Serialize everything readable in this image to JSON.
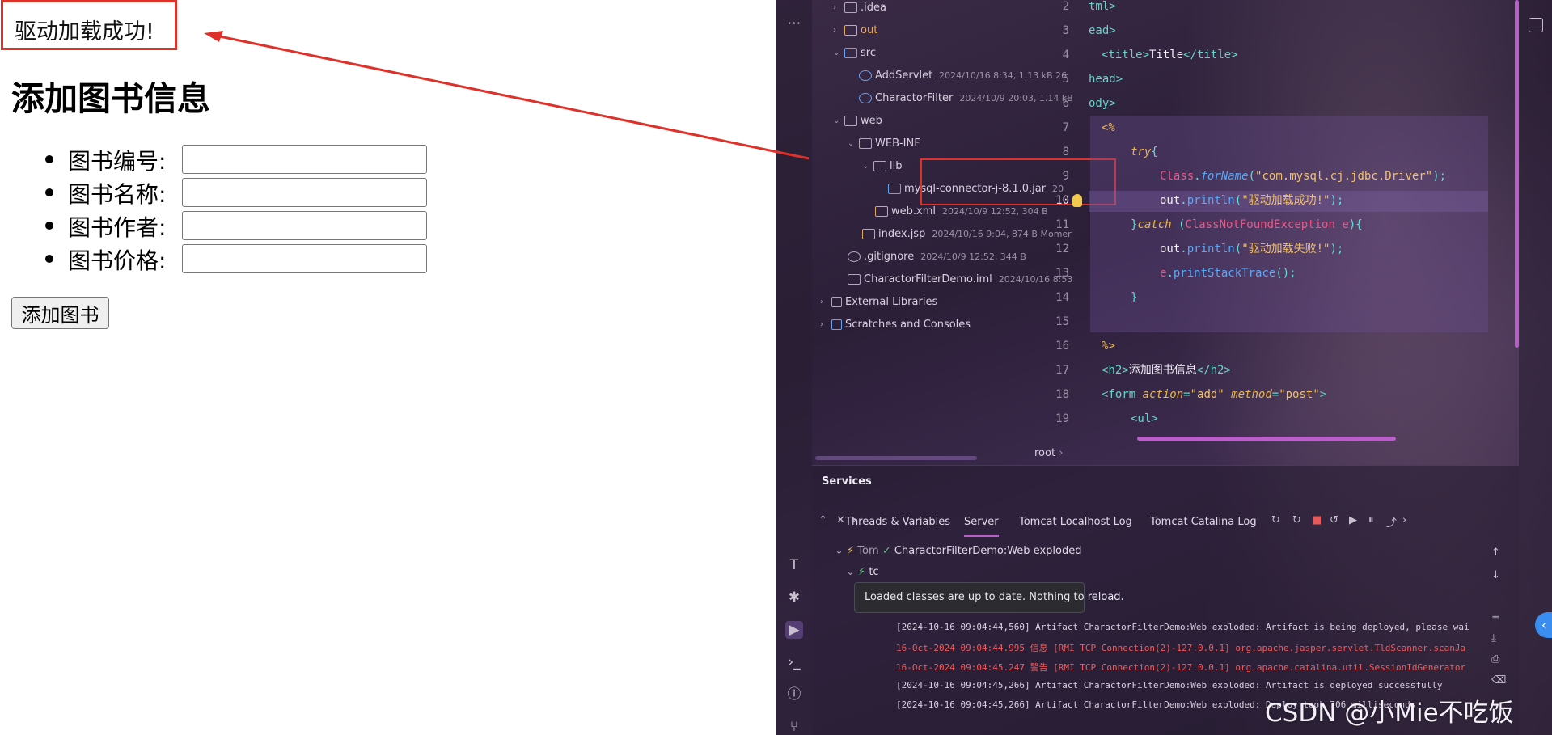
{
  "browser": {
    "alert_text": "驱动加载成功!",
    "heading": "添加图书信息",
    "fields": [
      {
        "label": "图书编号:",
        "value": ""
      },
      {
        "label": "图书名称:",
        "value": ""
      },
      {
        "label": "图书作者:",
        "value": ""
      },
      {
        "label": "图书价格:",
        "value": ""
      }
    ],
    "submit_label": "添加图书"
  },
  "ide": {
    "tree": [
      {
        "label": ".idea",
        "meta": ""
      },
      {
        "label": "out",
        "meta": ""
      },
      {
        "label": "src",
        "meta": ""
      },
      {
        "label": "AddServlet",
        "meta": "2024/10/16 8:34, 1.13 kB 26"
      },
      {
        "label": "CharactorFilter",
        "meta": "2024/10/9 20:03, 1.14 kB"
      },
      {
        "label": "web",
        "meta": ""
      },
      {
        "label": "WEB-INF",
        "meta": ""
      },
      {
        "label": "lib",
        "meta": ""
      },
      {
        "label": "mysql-connector-j-8.1.0.jar",
        "meta": "20"
      },
      {
        "label": "web.xml",
        "meta": "2024/10/9 12:52, 304 B"
      },
      {
        "label": "index.jsp",
        "meta": "2024/10/16 9:04, 874 B Momer"
      },
      {
        "label": ".gitignore",
        "meta": "2024/10/9 12:52, 344 B"
      },
      {
        "label": "CharactorFilterDemo.iml",
        "meta": "2024/10/16 8:53"
      },
      {
        "label": "External Libraries",
        "meta": ""
      },
      {
        "label": "Scratches and Consoles",
        "meta": ""
      }
    ],
    "line_numbers": [
      "2",
      "3",
      "4",
      "5",
      "6",
      "7",
      "8",
      "9",
      "10",
      "11",
      "12",
      "13",
      "14",
      "15",
      "16",
      "17",
      "18",
      "19"
    ],
    "breadcrumb": "root",
    "services": {
      "title": "Services",
      "tabs": [
        "Threads & Variables",
        "Server",
        "Tomcat Localhost Log",
        "Tomcat Catalina Log"
      ],
      "server_row": "CharactorFilterDemo:Web exploded",
      "server_prefix": "Tom",
      "child_prefix": "tc",
      "tooltip": "Loaded classes are up to date. Nothing to reload.",
      "logs": [
        {
          "text": "[2024-10-16 09:04:44,560] Artifact CharactorFilterDemo:Web exploded: Artifact is being deployed, please wai",
          "level": "info"
        },
        {
          "text": "16-Oct-2024 09:04:44.995 信息 [RMI TCP Connection(2)-127.0.0.1] org.apache.jasper.servlet.TldScanner.scanJa",
          "level": "error"
        },
        {
          "text": "16-Oct-2024 09:04:45.247 警告 [RMI TCP Connection(2)-127.0.0.1] org.apache.catalina.util.SessionIdGenerator",
          "level": "error"
        },
        {
          "text": "[2024-10-16 09:04:45,266] Artifact CharactorFilterDemo:Web exploded: Artifact is deployed successfully",
          "level": "info"
        },
        {
          "text": "[2024-10-16 09:04:45,266] Artifact CharactorFilterDemo:Web exploded: Deploy took 706 milliseconds",
          "level": "info"
        }
      ]
    }
  },
  "code_lines": {
    "l2a": "tml>",
    "l3a": "ead>",
    "l4_title": "Title",
    "l5a": "head>",
    "l6a": "ody>",
    "l7": "<%",
    "l8_kw": "try",
    "l9_cls": "Class",
    "l9_fn": "forName",
    "l9_str": "\"com.mysql.cj.jdbc.Driver\"",
    "l10_var": "out",
    "l10_meth": "println",
    "l10_str": "\"驱动加载成功!\"",
    "l11_kw": "catch",
    "l11_cls": "ClassNotFoundException",
    "l11_var": "e",
    "l12_var": "out",
    "l12_meth": "println",
    "l12_str": "\"驱动加载失败!\"",
    "l13_var": "e",
    "l13_meth": "printStackTrace",
    "l16": "%>",
    "l17_txt": "添加图书信息",
    "l18_action": "action",
    "l18_action_val": "\"add\"",
    "l18_method": "method",
    "l18_method_val": "\"post\""
  },
  "watermark": "CSDN @小Mie不吃饭",
  "colors": {
    "annotation_red": "#e0302a",
    "accent_purple": "#b860c8"
  }
}
